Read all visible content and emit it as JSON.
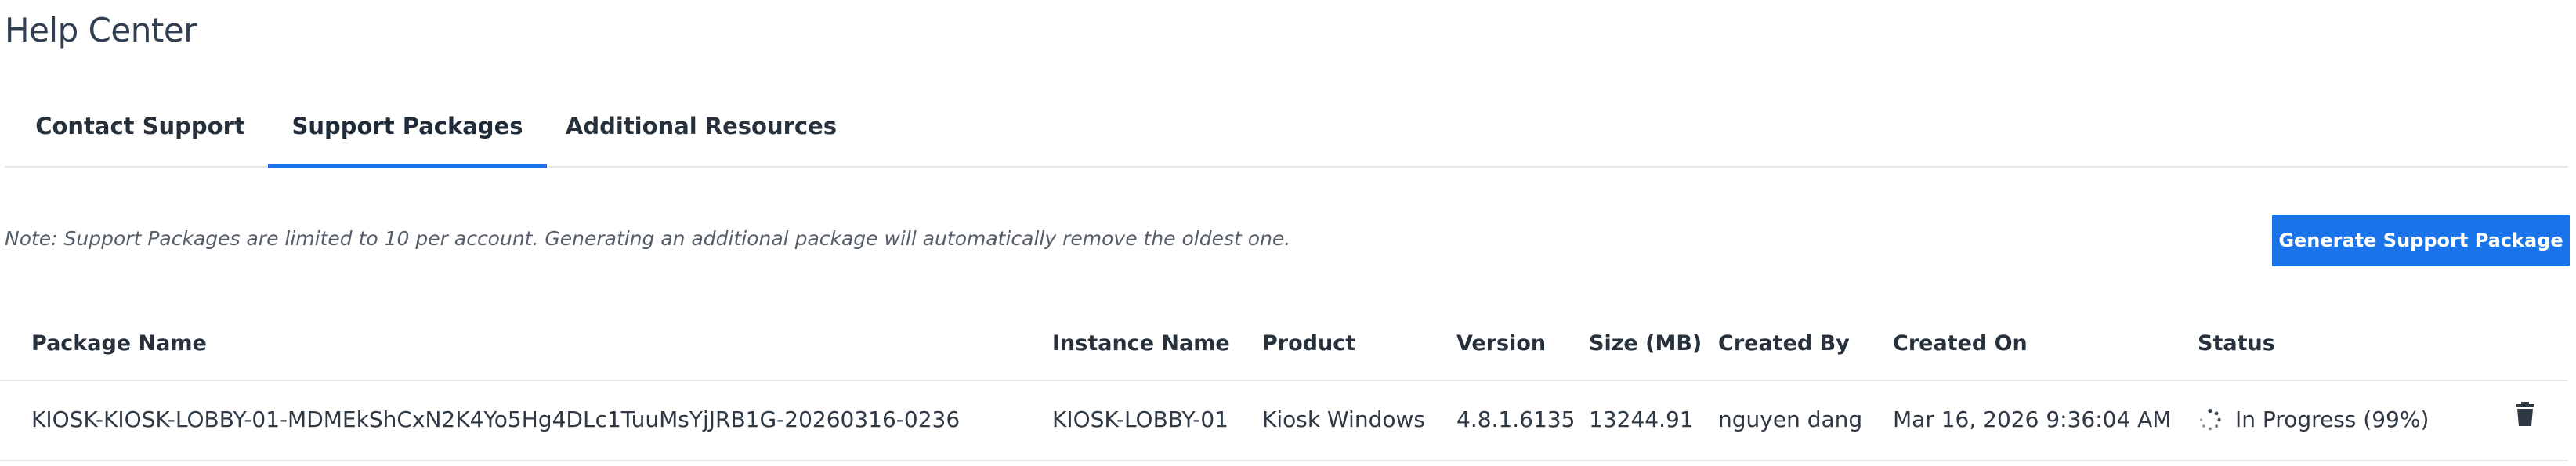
{
  "page": {
    "title": "Help Center"
  },
  "tabs": [
    {
      "label": "Contact Support"
    },
    {
      "label": "Support Packages"
    },
    {
      "label": "Additional Resources"
    }
  ],
  "note": "Note: Support Packages are limited to 10 per account. Generating an additional package will automatically remove the oldest one.",
  "generate_button": {
    "label": "Generate Support Package"
  },
  "table": {
    "columns": [
      "Package Name",
      "Instance Name",
      "Product",
      "Version",
      "Size (MB)",
      "Created By",
      "Created On",
      "Status"
    ],
    "rows": [
      {
        "package_name": "KIOSK-KIOSK-LOBBY-01-MDMEkShCxN2K4Yo5Hg4DLc1TuuMsYjJRB1G-20260316-0236",
        "instance_name": "KIOSK-LOBBY-01",
        "product": "Kiosk Windows",
        "version": "4.8.1.6135",
        "size": "13244.91",
        "created_by": "nguyen dang",
        "created_on": "Mar 16, 2026 9:36:04 AM",
        "status": "In Progress (99%)"
      }
    ]
  },
  "icons": {
    "status": "spinner-icon",
    "delete": "trash-icon"
  },
  "colors": {
    "accent": "#1a73e8",
    "divider": "#e3e6ea",
    "text": "#2e3945"
  }
}
